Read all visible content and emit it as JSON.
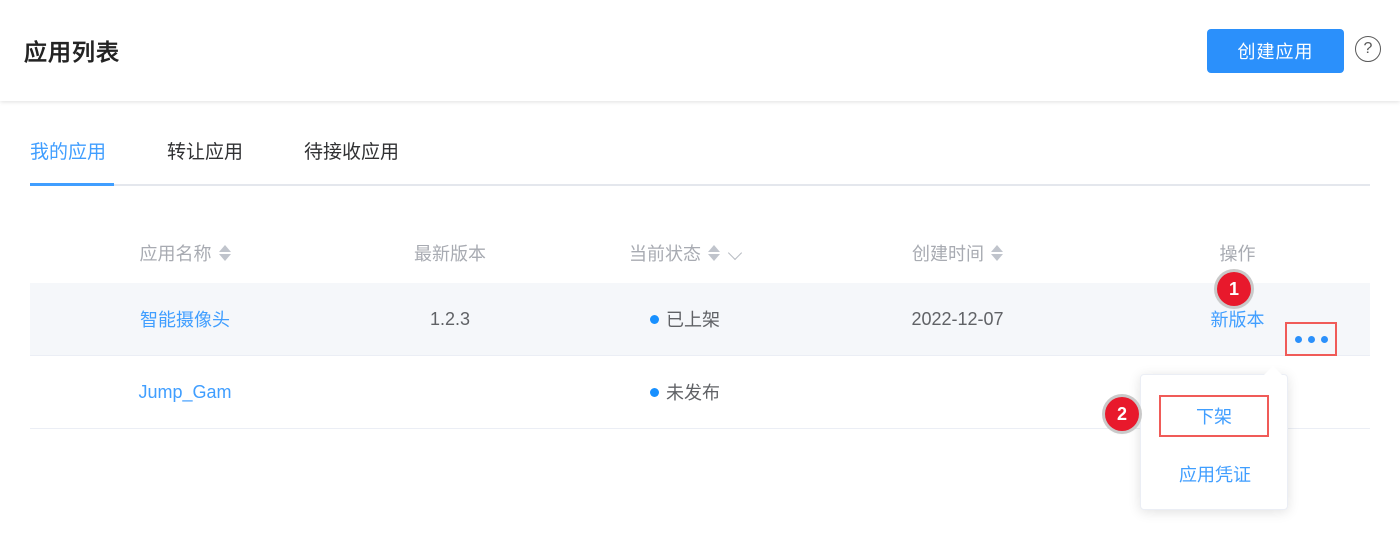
{
  "header": {
    "title": "应用列表",
    "create_button": "创建应用",
    "help_icon": "question-circle-icon",
    "help_glyph": "?"
  },
  "tabs": [
    {
      "label": "我的应用",
      "active": true
    },
    {
      "label": "转让应用",
      "active": false
    },
    {
      "label": "待接收应用",
      "active": false
    }
  ],
  "table": {
    "columns": [
      {
        "label": "应用名称",
        "sortable": true,
        "filterable": false
      },
      {
        "label": "最新版本",
        "sortable": false,
        "filterable": false
      },
      {
        "label": "当前状态",
        "sortable": true,
        "filterable": true
      },
      {
        "label": "创建时间",
        "sortable": true,
        "filterable": false
      },
      {
        "label": "操作",
        "sortable": false,
        "filterable": false
      }
    ],
    "rows": [
      {
        "name": "智能摄像头",
        "version": "1.2.3",
        "status": "已上架",
        "status_color": "#1890ff",
        "created": "2022-12-07",
        "action_link": "新版本",
        "more_icon": "ellipsis-icon"
      },
      {
        "name": "Jump_Gam",
        "version": "",
        "status": "未发布",
        "status_color": "#1890ff",
        "created": "",
        "action_link": "",
        "more_icon": ""
      }
    ]
  },
  "dropdown": {
    "items": [
      {
        "label": "下架",
        "highlighted": true
      },
      {
        "label": "应用凭证",
        "highlighted": false
      }
    ]
  },
  "annotations": {
    "badges": [
      {
        "number": "1"
      },
      {
        "number": "2"
      }
    ]
  },
  "colors": {
    "accent": "#409eff",
    "button": "#2b90fb",
    "highlight_box": "#f05b58",
    "badge": "#e8192c",
    "row_highlight": "#f5f7fa",
    "status_dot": "#1890ff"
  }
}
